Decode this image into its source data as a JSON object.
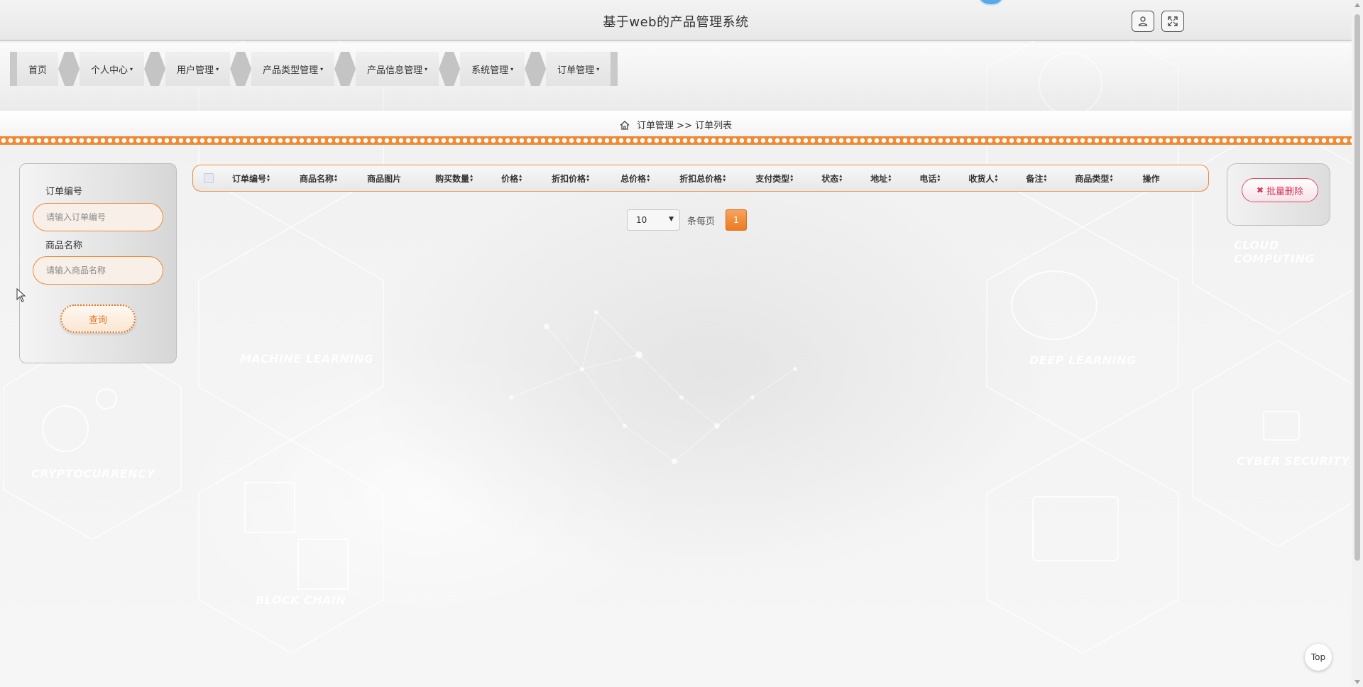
{
  "header": {
    "title": "基于web的产品管理系统"
  },
  "nav": {
    "items": [
      {
        "label": "首页",
        "caret": ""
      },
      {
        "label": "个人中心",
        "caret": "▾"
      },
      {
        "label": "用户管理",
        "caret": "▾"
      },
      {
        "label": "产品类型管理",
        "caret": "▾"
      },
      {
        "label": "产品信息管理",
        "caret": "▾"
      },
      {
        "label": "系统管理",
        "caret": "▾"
      },
      {
        "label": "订单管理",
        "caret": "▾"
      }
    ]
  },
  "breadcrumb": {
    "parent": "订单管理",
    "separator": ">>",
    "current": "订单列表"
  },
  "search": {
    "order_no_label": "订单编号",
    "order_no_placeholder": "请输入订单编号",
    "product_name_label": "商品名称",
    "product_name_placeholder": "请输入商品名称",
    "button_label": "查询"
  },
  "table": {
    "columns": [
      {
        "label": "订单编号",
        "sortable": true
      },
      {
        "label": "商品名称",
        "sortable": true
      },
      {
        "label": "商品图片",
        "sortable": false
      },
      {
        "label": "购买数量",
        "sortable": true
      },
      {
        "label": "价格",
        "sortable": true
      },
      {
        "label": "折扣价格",
        "sortable": true
      },
      {
        "label": "总价格",
        "sortable": true
      },
      {
        "label": "折扣总价格",
        "sortable": true
      },
      {
        "label": "支付类型",
        "sortable": true
      },
      {
        "label": "状态",
        "sortable": true
      },
      {
        "label": "地址",
        "sortable": true
      },
      {
        "label": "电话",
        "sortable": true
      },
      {
        "label": "收货人",
        "sortable": true
      },
      {
        "label": "备注",
        "sortable": true
      },
      {
        "label": "商品类型",
        "sortable": true
      },
      {
        "label": "操作",
        "sortable": false
      }
    ]
  },
  "pager": {
    "page_size": "10",
    "page_size_label": "条每页",
    "current_page": "1"
  },
  "actions": {
    "batch_delete_label": "批量删除"
  },
  "background": {
    "words": [
      "MACHINE LEARNING",
      "CRYPTOCURRENCY",
      "BLOCK CHAIN",
      "DEEP LEARNING",
      "CLOUD COMPUTING",
      "CYBER SECURITY"
    ]
  },
  "top_button": "Top",
  "colors": {
    "accent": "#f08a34",
    "danger": "#d8345a"
  }
}
